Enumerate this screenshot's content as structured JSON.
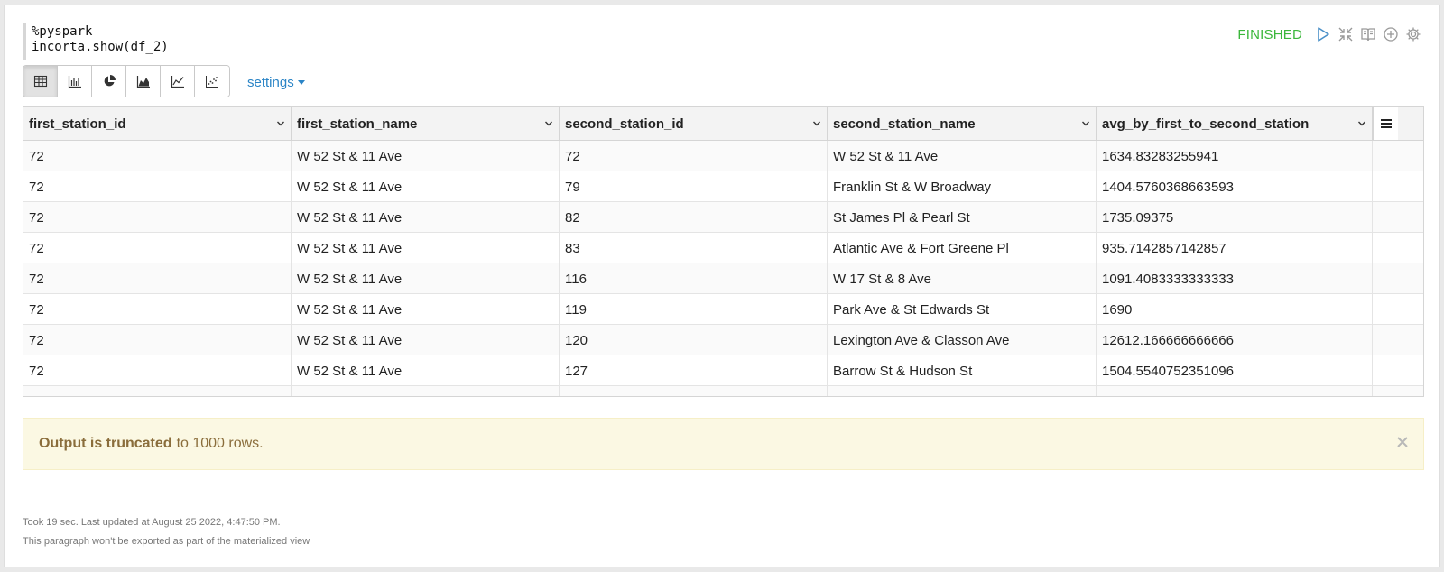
{
  "editor": {
    "lines": [
      "%pyspark",
      "incorta.show(df_2)"
    ]
  },
  "status": "FINISHED",
  "toolbar_icons": [
    "run-icon",
    "collapse-icon",
    "book-icon",
    "add-icon",
    "gear-icon"
  ],
  "visualizations": [
    "table-icon",
    "bar-chart-icon",
    "pie-chart-icon",
    "area-chart-icon",
    "line-chart-icon",
    "scatter-chart-icon"
  ],
  "settings_label": "settings",
  "table": {
    "columns": [
      "first_station_id",
      "first_station_name",
      "second_station_id",
      "second_station_name",
      "avg_by_first_to_second_station"
    ],
    "rows": [
      [
        "72",
        "W 52 St & 11 Ave",
        "72",
        "W 52 St & 11 Ave",
        "1634.83283255941"
      ],
      [
        "72",
        "W 52 St & 11 Ave",
        "79",
        "Franklin St & W Broadway",
        "1404.5760368663593"
      ],
      [
        "72",
        "W 52 St & 11 Ave",
        "82",
        "St James Pl & Pearl St",
        "1735.09375"
      ],
      [
        "72",
        "W 52 St & 11 Ave",
        "83",
        "Atlantic Ave & Fort Greene Pl",
        "935.7142857142857"
      ],
      [
        "72",
        "W 52 St & 11 Ave",
        "116",
        "W 17 St & 8 Ave",
        "1091.4083333333333"
      ],
      [
        "72",
        "W 52 St & 11 Ave",
        "119",
        "Park Ave & St Edwards St",
        "1690"
      ],
      [
        "72",
        "W 52 St & 11 Ave",
        "120",
        "Lexington Ave & Classon Ave",
        "12612.166666666666"
      ],
      [
        "72",
        "W 52 St & 11 Ave",
        "127",
        "Barrow St & Hudson St",
        "1504.5540752351096"
      ]
    ]
  },
  "alert": {
    "bold": "Output is truncated",
    "rest": "to 1000 rows."
  },
  "footer": {
    "timing": "Took 19 sec. Last updated at August 25 2022, 4:47:50 PM.",
    "note": "This paragraph won't be exported as part of the materialized view"
  },
  "colors": {
    "status": "#3cb73c",
    "link": "#2a84c6",
    "alert_bg": "#fbf8e3",
    "alert_text": "#8a6d3b"
  }
}
